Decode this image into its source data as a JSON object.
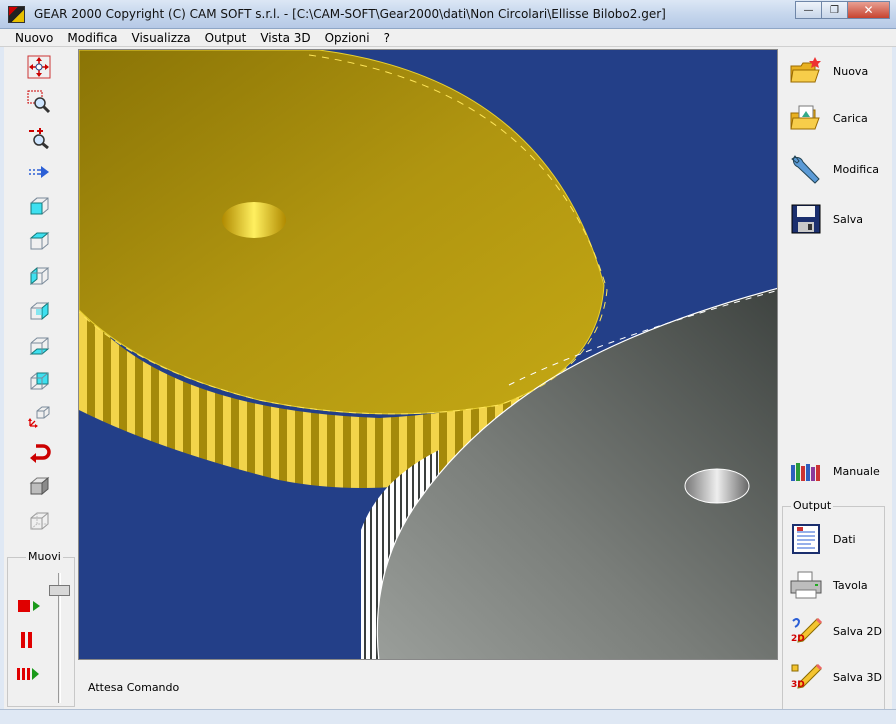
{
  "window": {
    "title": "GEAR 2000     Copyright (C)  CAM SOFT s.r.l. - [C:\\CAM-SOFT\\Gear2000\\dati\\Non Circolari\\Ellisse Bilobo2.ger]",
    "minimize_glyph": "—",
    "restore_glyph": "❐",
    "close_glyph": "✕"
  },
  "menu": [
    "Nuovo",
    "Modifica",
    "Visualizza",
    "Output",
    "Vista 3D",
    "Opzioni",
    "?"
  ],
  "left_toolbar": {
    "icons": [
      "move-view-icon",
      "zoom-window-icon",
      "zoom-in-out-icon",
      "pan-icon",
      "view-front-icon",
      "view-top-icon",
      "view-left-icon",
      "view-right-icon",
      "view-bottom-icon",
      "view-back-icon",
      "view-iso-icon",
      "rotate-back-icon",
      "solid-view-icon",
      "wireframe-view-icon"
    ],
    "muovi_label": "Muovi",
    "slider_value": 0.9
  },
  "status": {
    "text": "Attesa Comando"
  },
  "right_panel": {
    "buttons": [
      {
        "label": "Nuova",
        "icon": "new-folder-icon"
      },
      {
        "label": "Carica",
        "icon": "open-folder-icon"
      },
      {
        "label": "Modifica",
        "icon": "wrench-icon"
      },
      {
        "label": "Salva",
        "icon": "floppy-disk-icon"
      },
      {
        "label": "Manuale",
        "icon": "books-icon"
      }
    ],
    "output_label": "Output",
    "output_buttons": [
      {
        "label": "Dati",
        "icon": "data-sheet-icon"
      },
      {
        "label": "Tavola",
        "icon": "printer-icon"
      },
      {
        "label": "Salva 2D",
        "icon": "save-2d-icon",
        "badge": "2D"
      },
      {
        "label": "Salva 3D",
        "icon": "save-3d-icon",
        "badge": "3D"
      }
    ]
  },
  "colors": {
    "viewport_bg": "#233f88",
    "gear_yellow": "#b3980c",
    "gear_gray": "#6f7370",
    "accent_red": "#d00000"
  }
}
